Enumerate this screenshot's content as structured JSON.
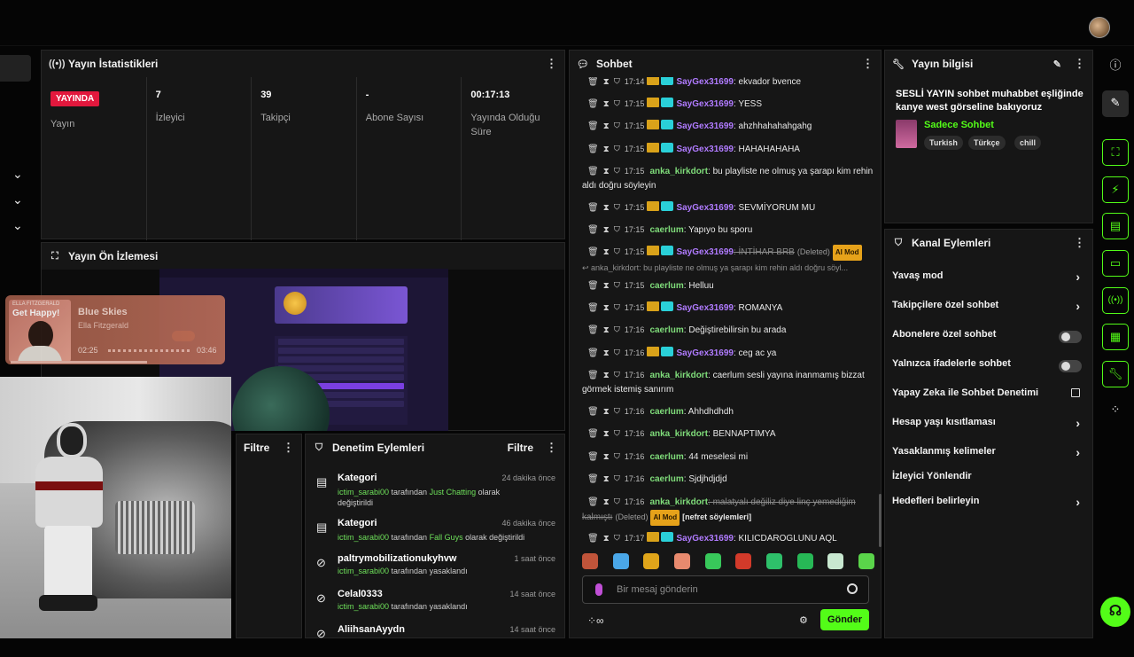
{
  "stats": {
    "title": "Yayın İstatistikleri",
    "live_badge": "YAYINDA",
    "live_label": "Yayın",
    "viewers_value": "7",
    "viewers_label": "İzleyici",
    "followers_value": "39",
    "followers_label": "Takipçi",
    "subs_value": "-",
    "subs_label": "Abone Sayısı",
    "uptime_value": "00:17:13",
    "uptime_label": "Yayında Olduğu Süre"
  },
  "preview": {
    "title": "Yayın Ön İzlemesi"
  },
  "music": {
    "album_small": "ELLA FITZGERALD",
    "album_text": "Get Happy!",
    "title": "Blue Skies",
    "artist": "Ella Fitzgerald",
    "elapsed": "02:25",
    "total": "03:46",
    "progress": 0.64
  },
  "filter_panel": {
    "title": "Filtre"
  },
  "moderation": {
    "title": "Denetim Eylemleri",
    "filter": "Filtre",
    "items": [
      {
        "title": "Kategori",
        "time": "24 dakika önce",
        "user": "ictim_sarabi00",
        "mid": " tarafından ",
        "target": "Just Chatting",
        "end": " olarak değiştirildi"
      },
      {
        "title": "Kategori",
        "time": "46 dakika önce",
        "user": "ictim_sarabi00",
        "mid": " tarafından ",
        "target": "Fall Guys",
        "end": " olarak değiştirildi"
      },
      {
        "title": "paltrymobilizationukyhvw",
        "time": "1 saat önce",
        "user": "ictim_sarabi00",
        "mid": " tarafından yasaklandı",
        "target": "",
        "end": ""
      },
      {
        "title": "Celal0333",
        "time": "14 saat önce",
        "user": "ictim_sarabi00",
        "mid": " tarafından yasaklandı",
        "target": "",
        "end": ""
      },
      {
        "title": "AliihsanAyydn",
        "time": "14 saat önce",
        "user": "",
        "mid": "",
        "target": "",
        "end": ""
      }
    ]
  },
  "chat": {
    "title": "Sohbet",
    "messages": [
      {
        "time": "17:14",
        "user": "SayGex31699",
        "text": ": ekvador bvence"
      },
      {
        "time": "17:15",
        "user": "SayGex31699",
        "text": ": YESS"
      },
      {
        "time": "17:15",
        "user": "SayGex31699",
        "text": ": ahzhhahahahgahg"
      },
      {
        "time": "17:15",
        "user": "SayGex31699",
        "text": ": HAHAHAHAHA"
      },
      {
        "time": "17:15",
        "user": "anka_kirkdort",
        "text": ": bu playliste ne olmuş ya şarapı kim rehin aldı doğru söyleyin"
      },
      {
        "time": "17:15",
        "user": "SayGex31699",
        "text": ": SEVMİYORUM MU"
      },
      {
        "time": "17:15",
        "user": "caerlum",
        "text": ": Yapıyo bu sporu"
      },
      {
        "time": "17:15",
        "user": "SayGex31699",
        "text": ": İNTİHAR BRB",
        "deleted": "(Deleted)",
        "tag": "AI Mod"
      },
      {
        "time": "17:15",
        "user": "caerlum",
        "text": ": Helluu"
      },
      {
        "time": "17:15",
        "user": "SayGex31699",
        "text": ": ROMANYA"
      },
      {
        "time": "17:16",
        "user": "caerlum",
        "text": ": Değiştirebilirsin bu arada"
      },
      {
        "time": "17:16",
        "user": "SayGex31699",
        "text": ": ceg ac ya"
      },
      {
        "time": "17:16",
        "user": "anka_kirkdort",
        "text": ": caerlum sesli yayına inanmamış bizzat görmek istemiş sanırım"
      },
      {
        "time": "17:16",
        "user": "caerlum",
        "text": ": Ahhdhdhdh"
      },
      {
        "time": "17:16",
        "user": "anka_kirkdort",
        "text": ": BENNAPTIMYA"
      },
      {
        "time": "17:16",
        "user": "caerlum",
        "text": ": 44 meselesi mi"
      },
      {
        "time": "17:16",
        "user": "caerlum",
        "text": ": Sjdjhdjdjd"
      },
      {
        "time": "17:16",
        "user": "anka_kirkdort",
        "text": ": malatyalı değiliz diye linç yemediğim kalmıştı",
        "deleted": "(Deleted)",
        "tag": "AI Mod",
        "reason": "[nefret söylemleri]"
      },
      {
        "time": "17:17",
        "user": "SayGex31699",
        "text": ": KILICDAROGLUNU AQL"
      }
    ],
    "reply_preview": "anka_kirkdort: bu playliste ne olmuş ya şarapı kim rehin aldı doğru söyl...",
    "input_placeholder": "Bir mesaj gönderin",
    "send_label": "Gönder"
  },
  "stream_info": {
    "title": "Yayın bilgisi",
    "stream_title": "SESLİ YAYIN sohbet muhabbet eşliğinde kanye west görseline bakıyoruz",
    "category": "Sadece Sohbet",
    "tags": [
      "Turkish",
      "Türkçe",
      "chill"
    ]
  },
  "channel_actions": {
    "title": "Kanal Eylemleri",
    "items": [
      "Yavaş mod",
      "Takipçilere özel sohbet",
      "Abonelere özel sohbet",
      "Yalnızca ifadelerle sohbet",
      "Yapay Zeka ile Sohbet Denetimi",
      "Hesap yaşı kısıtlaması",
      "Yasaklanmış kelimeler",
      "İzleyici Yönlendir",
      "Hedefleri belirleyin"
    ]
  },
  "colors": {
    "accent": "#53fc18",
    "live": "#e2183d",
    "panel": "#161616"
  }
}
